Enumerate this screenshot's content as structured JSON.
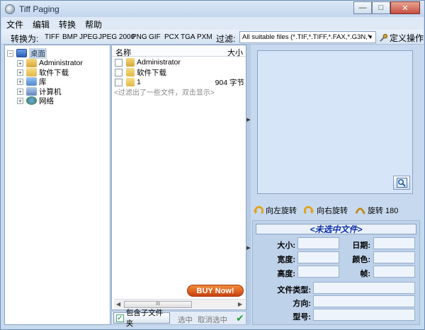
{
  "window": {
    "title": "Tiff Paging",
    "minimize": "—",
    "maximize": "□",
    "close": "✕"
  },
  "menu": [
    "文件",
    "编辑",
    "转换",
    "帮助"
  ],
  "toolbar": {
    "convert_label": "转换为:",
    "formats": [
      "TIFF",
      "BMP",
      "JPEG",
      "JPEG 2000",
      "PNG",
      "GIF",
      "PCX",
      "TGA",
      "PXM"
    ],
    "filter_label": "过滤:",
    "filter_value": "All suitable files (*.TIF,*.TIFF,*.FAX,*.G3N,*",
    "custom_label": "定义操作"
  },
  "tree": {
    "root": "桌面",
    "items": [
      "Administrator",
      "软件下载",
      "库",
      "计算机",
      "网络"
    ]
  },
  "filelist": {
    "col_name": "名称",
    "col_size": "大小",
    "rows": [
      {
        "name": "Administrator",
        "size": ""
      },
      {
        "name": "软件下载",
        "size": ""
      },
      {
        "name": "1",
        "size": "904 字节"
      }
    ],
    "hint": "<过滤出了一些文件，双击显示>",
    "scroll_thumb": "III"
  },
  "buy_now": "BUY Now!",
  "bottom_bar": {
    "include_subfolders": "包含子文件夹",
    "select": "选中",
    "deselect": "取消选中"
  },
  "rotate": {
    "left": "向左旋转",
    "right": "向右旋转",
    "r180": "旋转 180"
  },
  "info": {
    "title": "<未选中文件>",
    "size": "大小:",
    "date": "日期:",
    "width": "宽度:",
    "color": "颜色:",
    "height": "高度:",
    "frame": "帧:",
    "file_type": "文件类型:",
    "orientation": "方向:",
    "model": "型号:"
  }
}
